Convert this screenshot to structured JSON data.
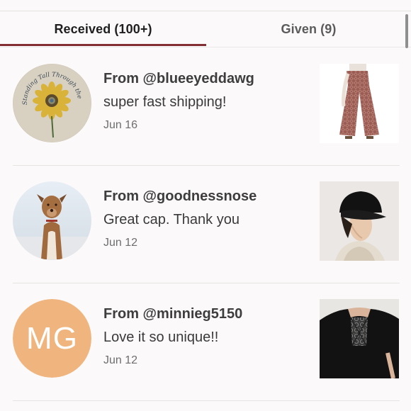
{
  "tabs": {
    "received_label": "Received (100+)",
    "given_label": "Given (9)"
  },
  "colors": {
    "accent": "#822e32",
    "initials_avatar": "#f0b57e"
  },
  "feedback": [
    {
      "from": "From @blueeyeddawg",
      "comment": "super fast shipping!",
      "date": "Jun 16",
      "avatar_icon": "sunflower-embroidery-avatar",
      "avatar_text": "Standing Tall Through the Storms of Life",
      "product_icon": "patterned-flare-pants-photo"
    },
    {
      "from": "From @goodnessnose",
      "comment": "Great cap. Thank you",
      "date": "Jun 12",
      "avatar_icon": "dog-photo-avatar",
      "product_icon": "black-cap-photo"
    },
    {
      "from": "From @minnieg5150",
      "comment": "Love it so unique!!",
      "date": "Jun 12",
      "avatar_initials": "MG",
      "product_icon": "lace-back-top-photo"
    }
  ]
}
